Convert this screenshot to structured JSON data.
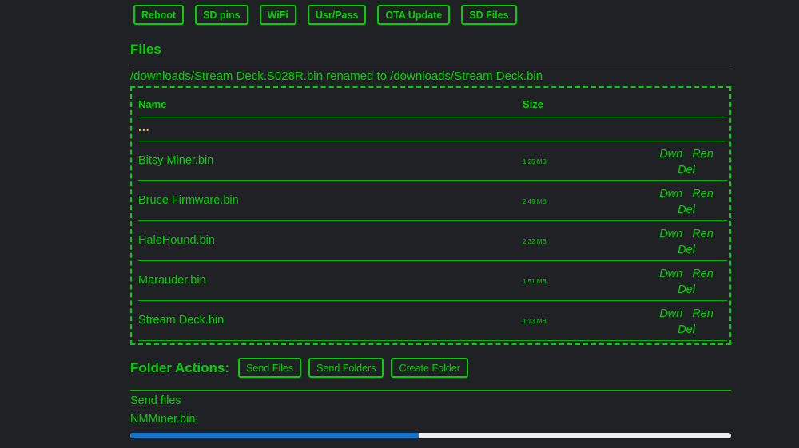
{
  "toolbar": {
    "buttons": [
      "Reboot",
      "SD pins",
      "WiFi",
      "Usr/Pass",
      "OTA Update",
      "SD Files"
    ]
  },
  "files_section": {
    "title": "Files",
    "status_message": "/downloads/Stream Deck.S028R.bin renamed to /downloads/Stream Deck.bin",
    "columns": {
      "name": "Name",
      "size": "Size"
    },
    "parent_dir": "...",
    "rows": [
      {
        "name": "Bitsy Miner.bin",
        "size": "1.25 MB"
      },
      {
        "name": "Bruce Firmware.bin",
        "size": "2.49 MB"
      },
      {
        "name": "HaleHound.bin",
        "size": "2.32 MB"
      },
      {
        "name": "Marauder.bin",
        "size": "1.51 MB"
      },
      {
        "name": "Stream Deck.bin",
        "size": "1.13 MB"
      }
    ],
    "actions": {
      "download": "Dwn",
      "rename": "Ren",
      "delete": "Del"
    }
  },
  "folder_actions": {
    "title": "Folder Actions:",
    "buttons": [
      "Send Files",
      "Send Folders",
      "Create Folder"
    ]
  },
  "upload": {
    "section_label": "Send files",
    "file_label": "NMMiner.bin:",
    "progress_fraction": 0.48
  },
  "colors": {
    "background": "#202124",
    "accent": "#00d400",
    "parent_dir": "#e8c000",
    "progress": "#1a73c7"
  }
}
